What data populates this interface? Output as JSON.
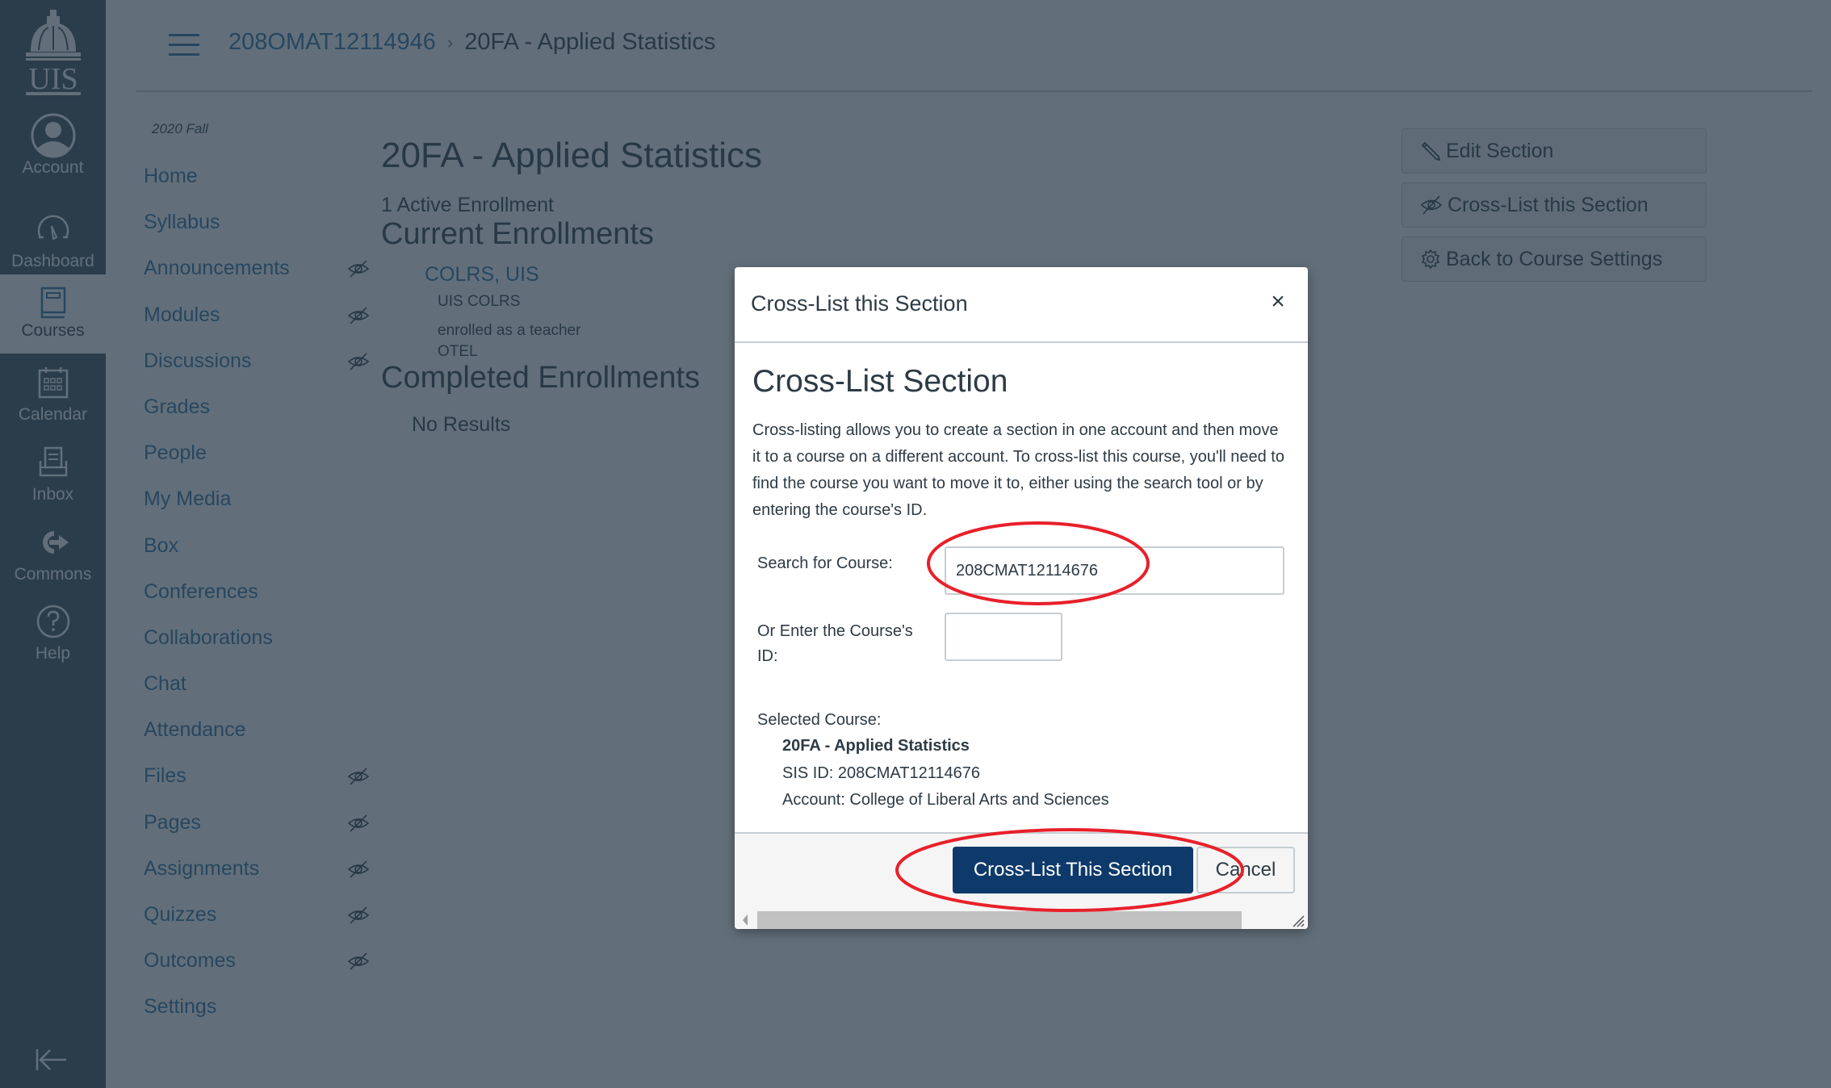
{
  "global_nav": {
    "logo": "UIS",
    "items": [
      {
        "label": "Account",
        "icon": "account-icon"
      },
      {
        "label": "Dashboard",
        "icon": "dashboard-icon"
      },
      {
        "label": "Courses",
        "icon": "courses-icon",
        "active": true
      },
      {
        "label": "Calendar",
        "icon": "calendar-icon"
      },
      {
        "label": "Inbox",
        "icon": "inbox-icon"
      },
      {
        "label": "Commons",
        "icon": "commons-icon"
      },
      {
        "label": "Help",
        "icon": "help-icon"
      }
    ],
    "collapse_icon": "collapse-nav-icon"
  },
  "header": {
    "breadcrumb": [
      {
        "label": "208OMAT12114946",
        "link": true
      },
      {
        "label": "20FA - Applied Statistics",
        "link": false
      }
    ],
    "separator": "›"
  },
  "course_nav": {
    "term": "2020 Fall",
    "items": [
      {
        "label": "Home",
        "hidden": false
      },
      {
        "label": "Syllabus",
        "hidden": false
      },
      {
        "label": "Announcements",
        "hidden": true
      },
      {
        "label": "Modules",
        "hidden": true
      },
      {
        "label": "Discussions",
        "hidden": true
      },
      {
        "label": "Grades",
        "hidden": false
      },
      {
        "label": "People",
        "hidden": false
      },
      {
        "label": "My Media",
        "hidden": false
      },
      {
        "label": "Box",
        "hidden": false
      },
      {
        "label": "Conferences",
        "hidden": false
      },
      {
        "label": "Collaborations",
        "hidden": false
      },
      {
        "label": "Chat",
        "hidden": false
      },
      {
        "label": "Attendance",
        "hidden": false
      },
      {
        "label": "Files",
        "hidden": true
      },
      {
        "label": "Pages",
        "hidden": true
      },
      {
        "label": "Assignments",
        "hidden": true
      },
      {
        "label": "Quizzes",
        "hidden": true
      },
      {
        "label": "Outcomes",
        "hidden": true
      },
      {
        "label": "Settings",
        "hidden": false
      }
    ]
  },
  "main": {
    "title": "20FA - Applied Statistics",
    "active_enrollments": "1 Active Enrollment",
    "current_heading": "Current Enrollments",
    "enrollment": {
      "name": "COLRS, UIS",
      "login": "UIS COLRS",
      "role": "enrolled as a teacher",
      "section": "OTEL"
    },
    "completed_heading": "Completed Enrollments",
    "completed_empty": "No Results"
  },
  "side_buttons": {
    "edit": "Edit Section",
    "crosslist": "Cross-List this Section",
    "back": "Back to Course Settings"
  },
  "dialog": {
    "title": "Cross-List this Section",
    "close": "×",
    "heading": "Cross-List Section",
    "description": "Cross-listing allows you to create a section in one account and then move it to a course on a different account. To cross-list this course, you'll need to find the course you want to move it to, either using the search tool or by entering the course's ID.",
    "search_label": "Search for Course:",
    "search_value": "208CMAT12114676",
    "id_label": "Or Enter the Course's ID:",
    "id_value": "",
    "selected_label": "Selected Course:",
    "selected_course": {
      "name": "20FA - Applied Statistics",
      "sis_id": "SIS ID: 208CMAT12114676",
      "account": "Account: College of Liberal Arts and Sciences"
    },
    "submit": "Cross-List This Section",
    "cancel": "Cancel"
  },
  "annotations": {
    "color": "#e8202a",
    "circled": [
      "search-for-course-input",
      "cross-list-submit-button"
    ]
  }
}
